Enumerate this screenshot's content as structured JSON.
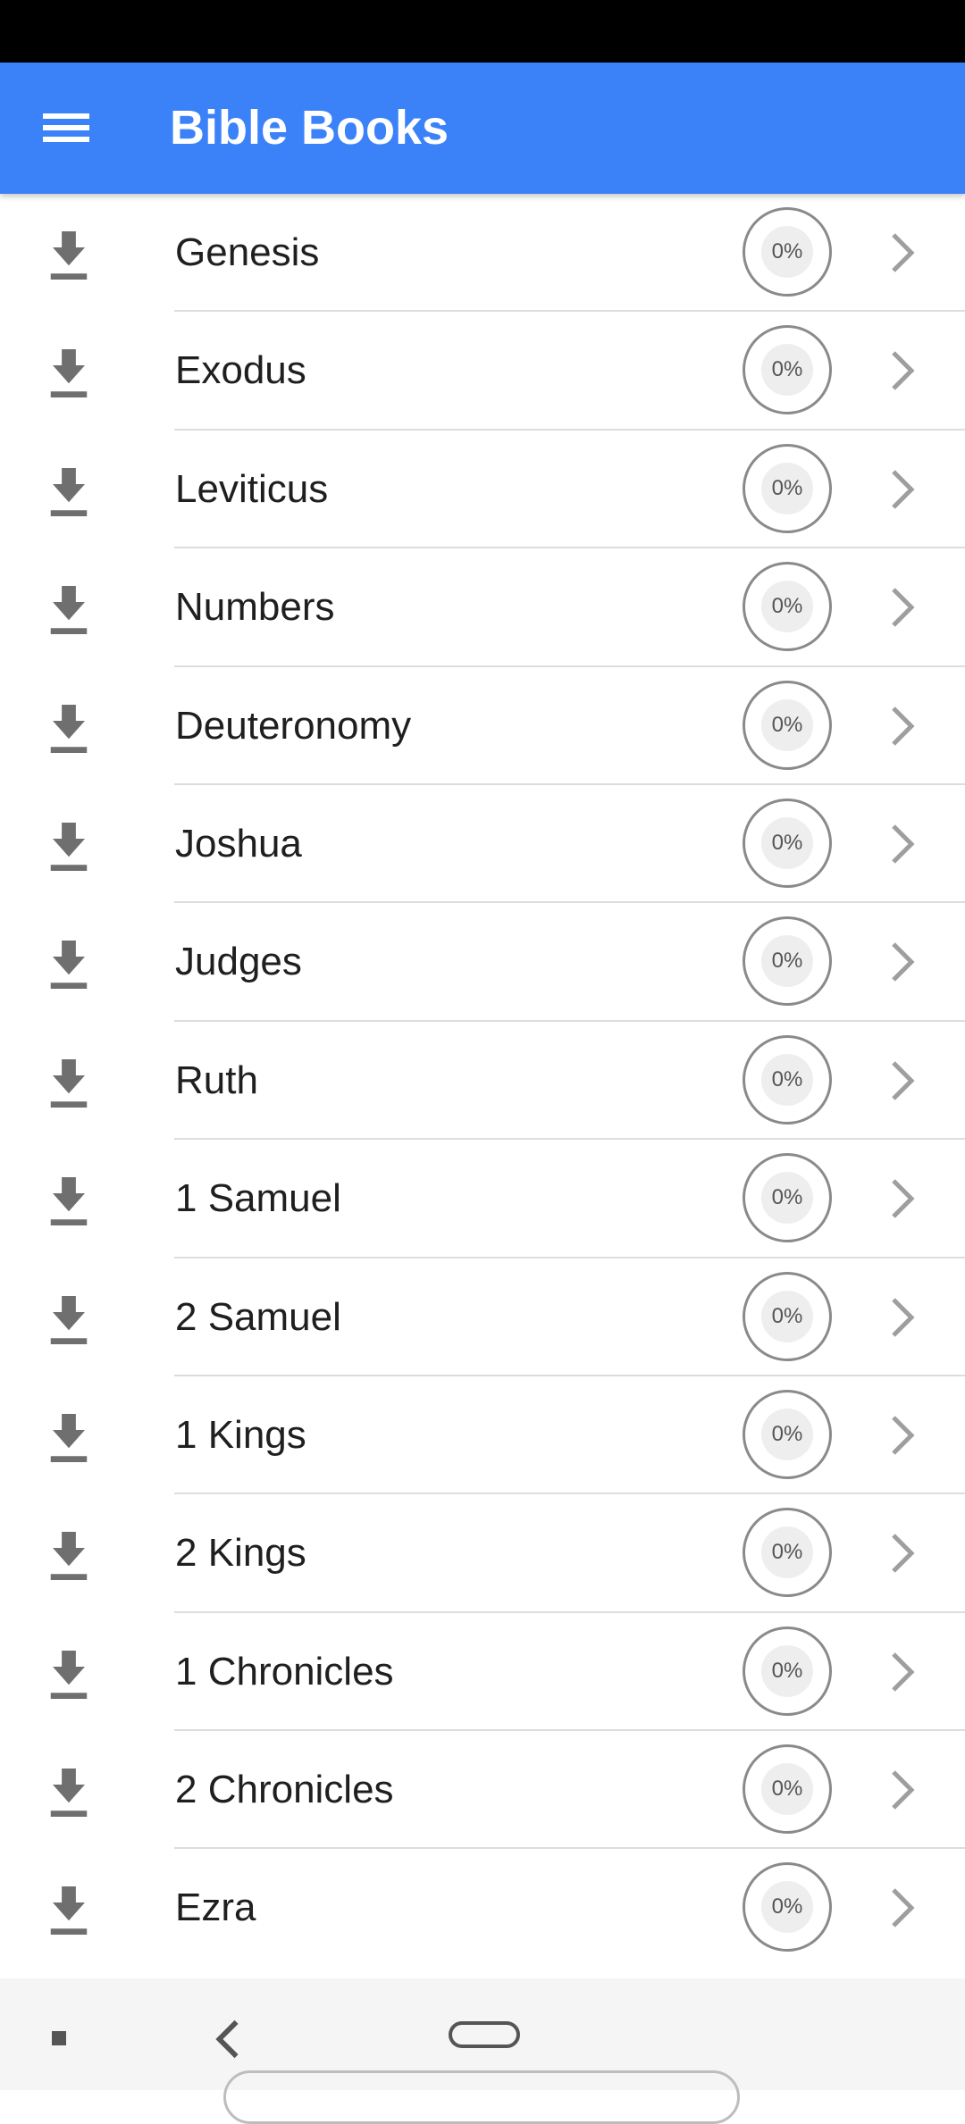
{
  "app_bar": {
    "title": "Bible Books",
    "menu_icon": "menu-icon",
    "background_color": "#3b82f8"
  },
  "books": [
    {
      "name": "Genesis",
      "progress": "0%"
    },
    {
      "name": "Exodus",
      "progress": "0%"
    },
    {
      "name": "Leviticus",
      "progress": "0%"
    },
    {
      "name": "Numbers",
      "progress": "0%"
    },
    {
      "name": "Deuteronomy",
      "progress": "0%"
    },
    {
      "name": "Joshua",
      "progress": "0%"
    },
    {
      "name": "Judges",
      "progress": "0%"
    },
    {
      "name": "Ruth",
      "progress": "0%"
    },
    {
      "name": "1 Samuel",
      "progress": "0%"
    },
    {
      "name": "2 Samuel",
      "progress": "0%"
    },
    {
      "name": "1 Kings",
      "progress": "0%"
    },
    {
      "name": "2 Kings",
      "progress": "0%"
    },
    {
      "name": "1 Chronicles",
      "progress": "0%"
    },
    {
      "name": "2 Chronicles",
      "progress": "0%"
    },
    {
      "name": "Ezra",
      "progress": "0%"
    }
  ],
  "row_icons": {
    "leading": "download-icon",
    "trailing": "chevron-right-icon"
  },
  "nav_bar": {
    "icons": [
      "recents-icon",
      "back-icon",
      "home-icon"
    ]
  }
}
